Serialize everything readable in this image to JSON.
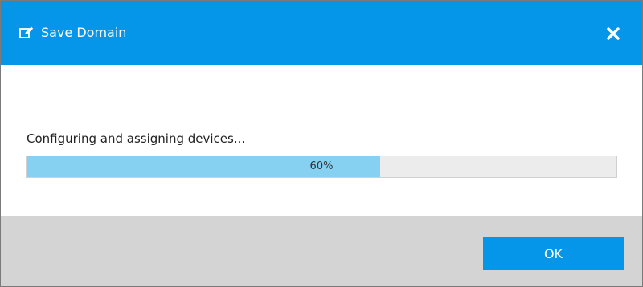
{
  "dialog": {
    "title": "Save Domain",
    "title_icon": "edit-icon",
    "close_icon": "close-icon"
  },
  "progress": {
    "status_text": "Configuring and assigning devices...",
    "value_percent": 60,
    "label": "60%"
  },
  "footer": {
    "ok_label": "OK"
  },
  "colors": {
    "accent": "#0596ea",
    "progress_fill": "#86d0f2",
    "progress_track": "#ececec",
    "footer_bg": "#d4d4d4"
  }
}
